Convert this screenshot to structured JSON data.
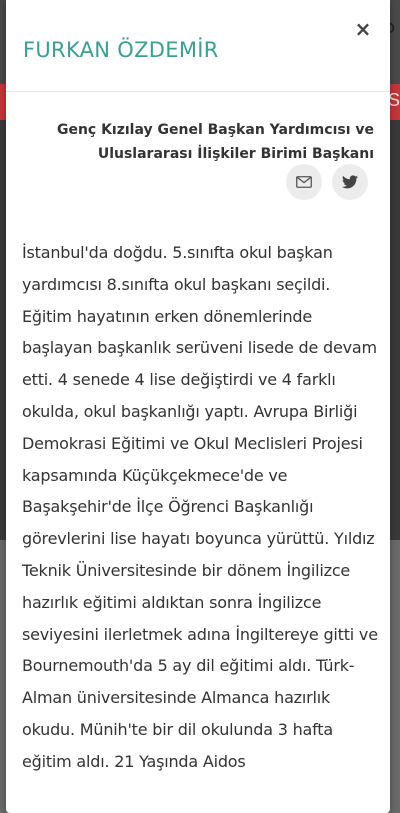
{
  "background": {
    "strip_text": "S",
    "search_glyph": "⚲"
  },
  "modal": {
    "title": "FURKAN ÖZDEMİR",
    "close_glyph": "×",
    "role": "Genç Kızılay Genel Başkan Yardımcısı ve Uluslararası İlişkiler Birimi Başkanı",
    "socials": [
      {
        "icon": "mail-icon"
      },
      {
        "icon": "twitter-icon"
      }
    ],
    "bio": "İstanbul'da doğdu. 5.sınıfta okul başkan yardımcısı 8.sınıfta okul başkanı seçildi. Eğitim hayatının erken dönemlerinde başlayan başkanlık serüveni lisede de devam etti. 4 senede 4 lise değiştirdi ve 4 farklı okulda, okul başkanlığı yaptı. Avrupa Birliği Demokrasi Eğitimi ve Okul Meclisleri Projesi kapsamında Küçükçekmece'de ve Başakşehir'de İlçe Öğrenci Başkanlığı görevlerini lise hayatı boyunca yürüttü. Yıldız Teknik Üniversitesinde bir dönem İngilizce hazırlık eğitimi aldıktan sonra İngilizce seviyesini ilerletmek adına İngiltereye gitti ve Bournemouth'da 5 ay dil eğitimi aldı. Türk-Alman üniversitesinde Almanca hazırlık okudu. Münih'te bir dil okulunda 3 hafta eğitim aldı. 21 Yaşında Aidos"
  },
  "colors": {
    "title": "#3a9f92",
    "text": "#333333",
    "social_bg": "#ececec",
    "backdrop_red": "#c6363a"
  }
}
